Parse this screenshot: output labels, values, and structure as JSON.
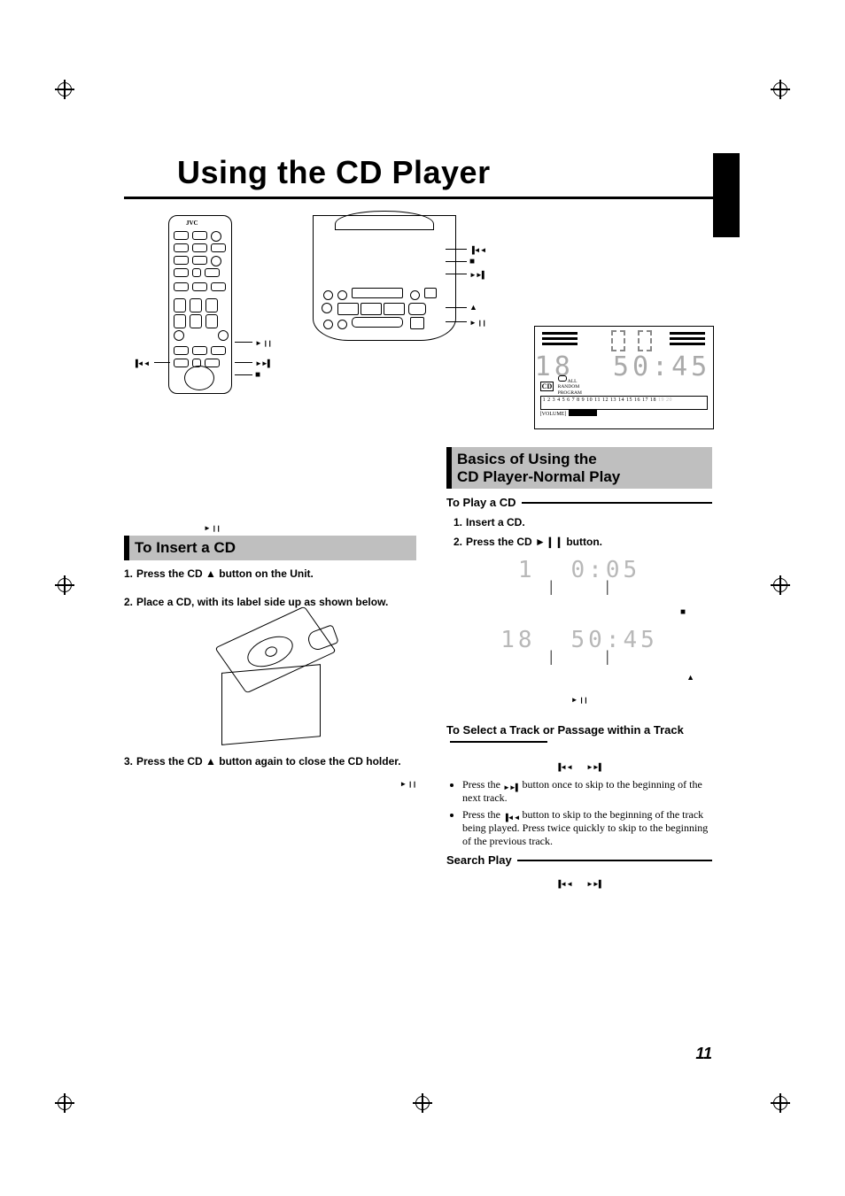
{
  "title": "Using the CD Player",
  "page_number": "11",
  "remote": {
    "brand": "JVC",
    "labels": {
      "play_pause": "►❙❙",
      "prev": "▐◄◄",
      "next": "►►▌",
      "stop": "■"
    }
  },
  "unit_labels": {
    "prev": "▐◄◄",
    "stop": "■",
    "next": "►►▌",
    "eject": "▲",
    "play_pause": "►❙❙"
  },
  "lcd": {
    "big_tracks": "18",
    "big_time": "50:45",
    "cd": "CD",
    "repeat_all": "ALL",
    "random": "RANDOM",
    "program": "PROGRAM",
    "track_list_on": "1 2 3 4 5 6 7 8 9 10 11 12 13 14 15 16 17 18",
    "track_list_off": "19 20",
    "volume_label": "VOLUME"
  },
  "left": {
    "heading": "To Insert a CD",
    "step1": "Press the CD ▲ button on the Unit.",
    "step2": "Place a CD, with its label side up as shown below.",
    "step3": "Press the CD ▲ button again to close the CD holder."
  },
  "right": {
    "heading_l1": "Basics of Using the",
    "heading_l2": "CD Player-Normal Play",
    "sub1": "To Play a CD",
    "step1": "Insert a CD.",
    "step2": "Press the CD ►❙❙ button.",
    "disp1_track": "1",
    "disp1_time": "0:05",
    "disp2_track": "18",
    "disp2_time": "50:45",
    "sub2": "To Select a Track or Passage within a Track",
    "bullet1_a": "Press the ",
    "bullet1_b": " button once to skip to the beginning of the next track.",
    "bullet2_a": "Press the ",
    "bullet2_b": " button to skip to the beginning of the track being played. Press twice quickly to skip to the beginning of the previous track.",
    "sub3": "Search Play"
  }
}
